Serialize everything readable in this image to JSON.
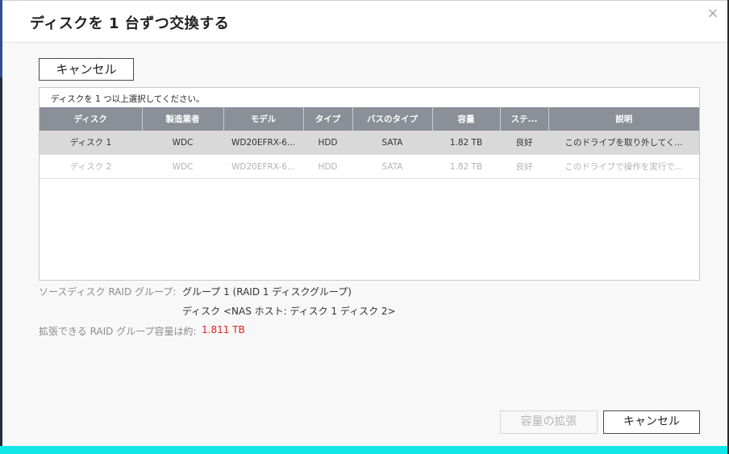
{
  "dialog": {
    "title": "ディスクを 1 台ずつ交換する",
    "close_glyph": "×"
  },
  "toolbar": {
    "cancel_label": "キャンセル"
  },
  "table": {
    "hint": "ディスクを 1 つ以上選択してください。",
    "columns": [
      "ディスク",
      "製造業者",
      "モデル",
      "タイプ",
      "バスのタイプ",
      "容量",
      "ステ...",
      "説明"
    ],
    "rows": [
      {
        "disk": "ディスク 1",
        "vendor": "WDC",
        "model": "WD20EFRX-6...",
        "type": "HDD",
        "bus": "SATA",
        "capacity": "1.82 TB",
        "status": "良好",
        "description": "このドライブを取り外してく..."
      },
      {
        "disk": "ディスク 2",
        "vendor": "WDC",
        "model": "WD20EFRX-6...",
        "type": "HDD",
        "bus": "SATA",
        "capacity": "1.82 TB",
        "status": "良好",
        "description": "このドライブで操作を実行で..."
      }
    ]
  },
  "info": {
    "source_label": "ソースディスク RAID グループ:",
    "source_group": "グループ 1 (RAID 1 ディスクグループ)",
    "source_disks": "ディスク <NAS ホスト: ディスク 1 ディスク 2>",
    "capacity_label": "拡張できる RAID グループ容量は約:",
    "capacity_value": "1.811 TB"
  },
  "footer": {
    "expand_label": "容量の拡張",
    "cancel_label": "キャンセル"
  },
  "colors": {
    "header_bg": "#8a8f98",
    "selected_row": "#d9d9d9",
    "capacity_text": "#e02020",
    "accent_strip": "#12e6e6"
  }
}
